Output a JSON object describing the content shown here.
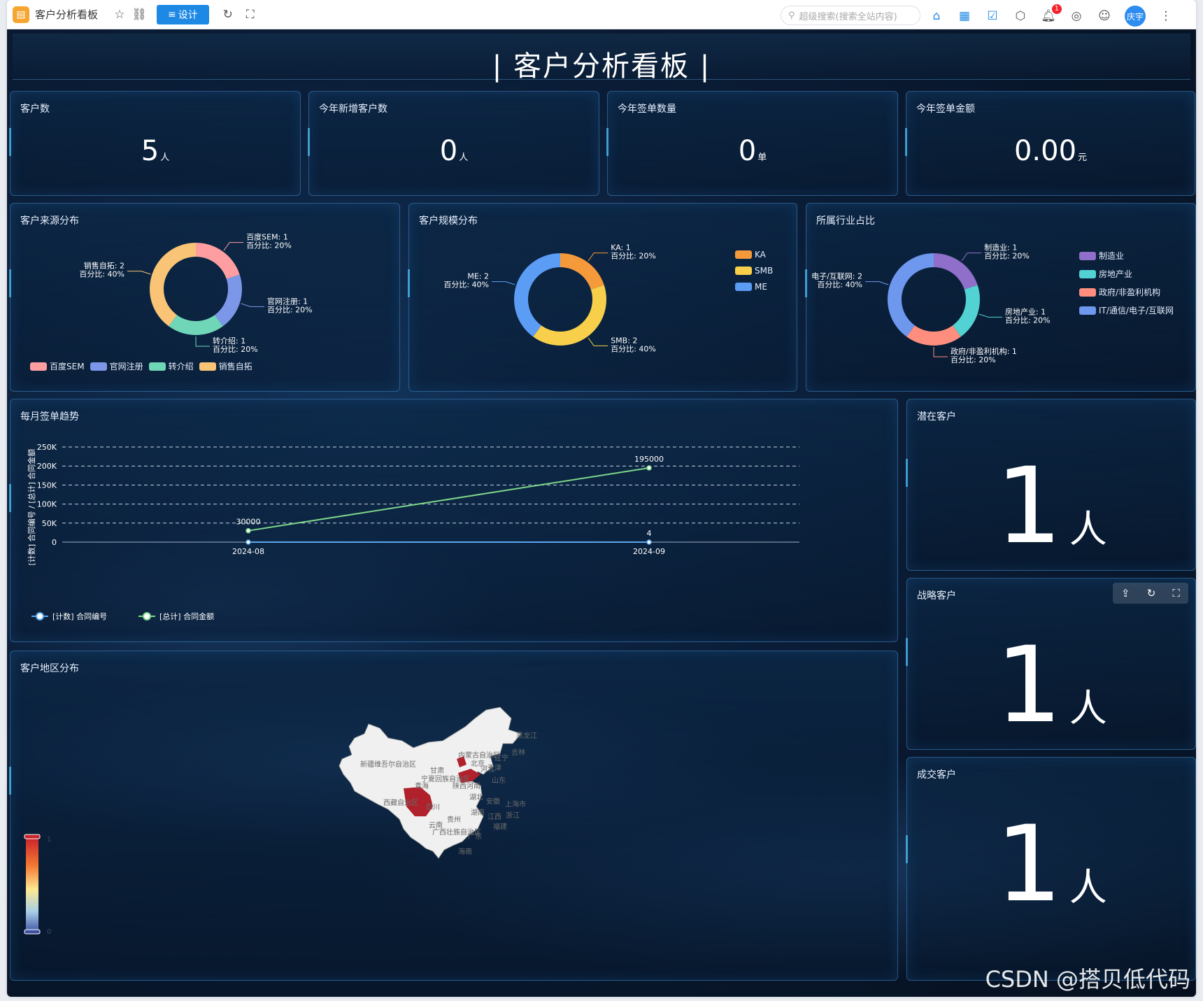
{
  "topbar": {
    "app_title": "客户分析看板",
    "design_label": "设计",
    "search_placeholder": "超级搜索(搜索全站内容)",
    "notification_count": "1",
    "user_name": "庆宇"
  },
  "dashboard": {
    "title": "| 客户分析看板 |",
    "kpis": [
      {
        "label": "客户数",
        "value": "5",
        "unit": "人"
      },
      {
        "label": "今年新增客户数",
        "value": "0",
        "unit": "人"
      },
      {
        "label": "今年签单数量",
        "value": "0",
        "unit": "单"
      },
      {
        "label": "今年签单金额",
        "value": "0.00",
        "unit": "元"
      }
    ],
    "source_title": "客户来源分布",
    "scale_title": "客户规模分布",
    "industry_title": "所属行业占比",
    "trend_title": "每月签单趋势",
    "map_title": "客户地区分布",
    "potential": {
      "label": "潜在客户",
      "value": "1",
      "unit": "人"
    },
    "strategic": {
      "label": "战略客户",
      "value": "1",
      "unit": "人"
    },
    "deal": {
      "label": "成交客户",
      "value": "1",
      "unit": "人"
    },
    "watermark": "CSDN @搭贝低代码",
    "map_scale": {
      "max": "1",
      "min": "0"
    },
    "map_labels": [
      "新疆维吾尔自治区",
      "西藏自治区",
      "青海",
      "内蒙古自治区",
      "黑龙江",
      "吉林",
      "宁夏回族自治区",
      "甘肃",
      "陕西",
      "四川",
      "山东",
      "湖北",
      "湖南",
      "贵州",
      "云南",
      "广西壮族自治区",
      "广东",
      "江西",
      "浙江",
      "福建",
      "安徽",
      "河南",
      "河北",
      "北京",
      "天津",
      "辽宁",
      "上海市",
      "海南"
    ]
  },
  "chart_data": [
    {
      "type": "pie",
      "title": "客户来源分布",
      "categories": [
        "百度SEM",
        "官网注册",
        "转介绍",
        "销售自拓"
      ],
      "values": [
        1,
        1,
        1,
        2
      ],
      "percent_labels": [
        "百分比: 20%",
        "百分比: 20%",
        "百分比: 20%",
        "百分比: 40%"
      ],
      "slice_labels": [
        "百度SEM: 1",
        "官网注册: 1",
        "转介绍: 1",
        "销售自拓: 2"
      ],
      "colors": [
        "#ff9ea0",
        "#7d97e8",
        "#6fd6b8",
        "#f9c475"
      ],
      "legend": "bottom"
    },
    {
      "type": "pie",
      "title": "客户规模分布",
      "categories": [
        "KA",
        "SMB",
        "ME"
      ],
      "values": [
        1,
        2,
        2
      ],
      "percent_labels": [
        "百分比: 20%",
        "百分比: 40%",
        "百分比: 40%"
      ],
      "slice_labels": [
        "KA: 1",
        "SMB: 2",
        "ME: 2"
      ],
      "colors": [
        "#f59a3a",
        "#f7cf4a",
        "#5b9cf5"
      ],
      "legend": "top-right"
    },
    {
      "type": "pie",
      "title": "所属行业占比",
      "categories": [
        "制造业",
        "房地产业",
        "政府/非盈利机构",
        "IT/通信/电子/互联网"
      ],
      "values": [
        1,
        1,
        1,
        2
      ],
      "percent_labels": [
        "百分比: 20%",
        "百分比: 20%",
        "百分比: 20%",
        "百分比: 40%"
      ],
      "slice_labels": [
        "制造业: 1",
        "房地产业: 1",
        "政府/非盈利机构: 1",
        "电子/互联网: 2"
      ],
      "colors": [
        "#8f6fc9",
        "#52d2d2",
        "#ff8e7e",
        "#6e97ee"
      ],
      "legend": "top-right"
    },
    {
      "type": "line",
      "title": "每月签单趋势",
      "x": [
        "2024-08",
        "2024-09"
      ],
      "ylabel": "[计数] 合同编号 / [总计] 合同金额",
      "yticks": [
        "0",
        "50K",
        "100K",
        "150K",
        "200K",
        "250K"
      ],
      "ylim": [
        0,
        250000
      ],
      "series": [
        {
          "name": "[计数] 合同编号",
          "values": [
            0,
            4
          ],
          "point_labels": [
            "",
            "4"
          ],
          "color": "#5aa7f0"
        },
        {
          "name": "[总计] 合同金额",
          "values": [
            30000,
            195000
          ],
          "point_labels": [
            "30000",
            "195000"
          ],
          "color": "#7ed68a"
        }
      ],
      "grid": true,
      "legend": "bottom-left"
    }
  ]
}
